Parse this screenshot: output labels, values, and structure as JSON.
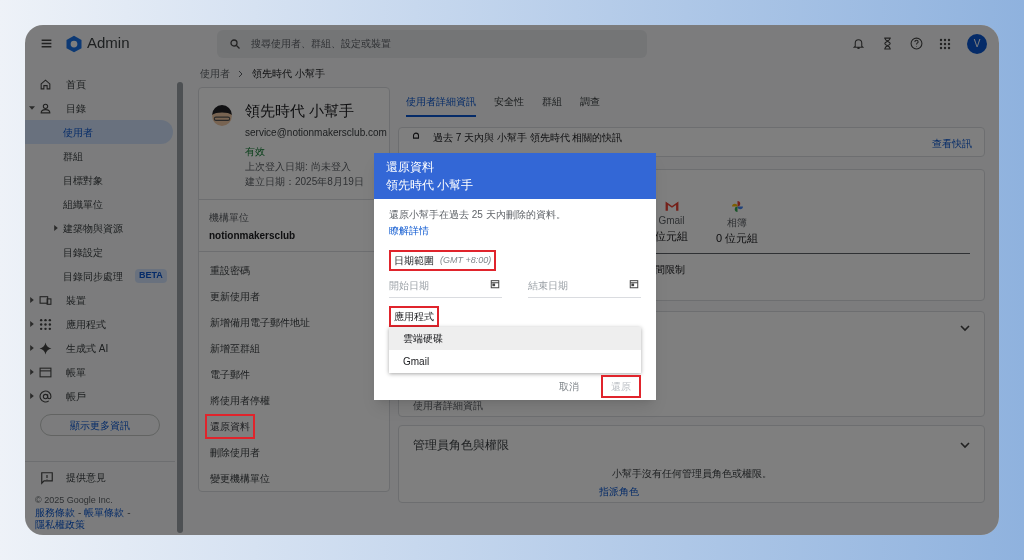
{
  "header": {
    "product": "Admin",
    "search": {
      "placeholder": "搜尋使用者、群組、設定或裝置"
    },
    "avatar": "V"
  },
  "sidebar": {
    "items": [
      {
        "label": "首頁"
      },
      {
        "label": "目錄",
        "expanded": true,
        "children": [
          {
            "label": "使用者",
            "selected": true
          },
          {
            "label": "群組",
            "selected": false
          },
          {
            "label": "目標對象",
            "selected": false
          },
          {
            "label": "組織單位",
            "selected": false
          },
          {
            "label": "建築物與資源",
            "selected": false,
            "expanded": false
          },
          {
            "label": "目錄設定",
            "selected": false
          },
          {
            "label": "目錄同步處理",
            "selected": false,
            "badge": "BETA"
          }
        ]
      },
      {
        "label": "裝置",
        "expanded": false
      },
      {
        "label": "應用程式",
        "expanded": false
      },
      {
        "label": "生成式 AI",
        "expanded": false
      },
      {
        "label": "帳單",
        "expanded": false
      },
      {
        "label": "帳戶",
        "expanded": false
      }
    ],
    "more_button": "顯示更多資訊",
    "feedback": "提供意見",
    "copyright": "© 2025 Google Inc.",
    "footer_links": [
      "服務條款",
      "帳單條款",
      "隱私權政策"
    ],
    "footer_separator": "-"
  },
  "breadcrumb": [
    "使用者",
    "領先時代 小幫手"
  ],
  "user_card": {
    "name": "領先時代 小幫手",
    "email": "service@notionmakersclub.com",
    "status": "有效",
    "last_login": "上次登入日期: 尚未登入",
    "created": "建立日期：2025年8月19日",
    "org_unit_label": "機構單位",
    "org_unit": "notionmakersclub",
    "actions": [
      {
        "label": "重設密碼",
        "highlighted": false
      },
      {
        "label": "更新使用者",
        "highlighted": false
      },
      {
        "label": "新增備用電子郵件地址",
        "highlighted": false
      },
      {
        "label": "新增至群組",
        "highlighted": false
      },
      {
        "label": "電子郵件",
        "highlighted": false
      },
      {
        "label": "將使用者停權",
        "highlighted": false
      },
      {
        "label": "還原資料",
        "highlighted": true
      },
      {
        "label": "刪除使用者",
        "highlighted": false
      },
      {
        "label": "變更機構單位",
        "highlighted": false
      }
    ]
  },
  "tabs": [
    {
      "label": "使用者詳細資訊",
      "selected": true
    },
    {
      "label": "安全性",
      "selected": false
    },
    {
      "label": "群組",
      "selected": false
    },
    {
      "label": "調查",
      "selected": false
    }
  ],
  "alert": {
    "text": "過去 7 天內與 小幫手 領先時代 相關的快訊",
    "link": "查看快訊"
  },
  "storage": {
    "items": [
      {
        "label": "Gmail",
        "value": "位元組"
      },
      {
        "label": "相簿",
        "value": "0 位元組"
      }
    ],
    "note": "間限制"
  },
  "details_card": {
    "text": "使用者詳細資訊"
  },
  "roles_card": {
    "title": "管理員角色與權限",
    "message": "小幫手沒有任何管理員角色或權限。",
    "link": "指派角色"
  },
  "dialog": {
    "title": "還原資料",
    "subtitle": "領先時代 小幫手",
    "description": "還原小幫手在過去 25 天內刪除的資料。",
    "link": "瞭解詳情",
    "date_range": {
      "label": "日期範圍",
      "timezone": "(GMT +8:00)",
      "highlighted": true
    },
    "start_date": {
      "placeholder": "開始日期"
    },
    "end_date": {
      "placeholder": "結束日期"
    },
    "apps": {
      "label": "應用程式",
      "highlighted": true,
      "options": [
        {
          "label": "雲端硬碟",
          "selected": true
        },
        {
          "label": "Gmail",
          "selected": false
        }
      ]
    },
    "buttons": [
      {
        "label": "取消",
        "kind": "text",
        "disabled": false,
        "highlighted": false
      },
      {
        "label": "還原",
        "kind": "primary",
        "disabled": true,
        "highlighted": true
      }
    ]
  }
}
